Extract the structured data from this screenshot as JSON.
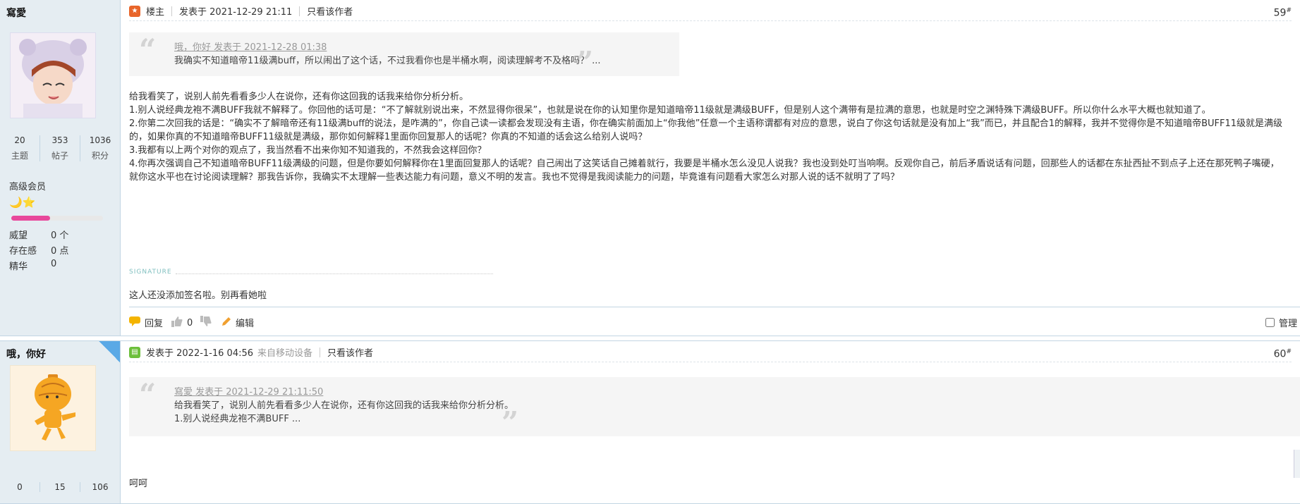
{
  "post1": {
    "user": {
      "name": "寫愛",
      "stats": [
        {
          "num": "20",
          "label": "主题"
        },
        {
          "num": "353",
          "label": "帖子"
        },
        {
          "num": "1036",
          "label": "积分"
        }
      ],
      "rank": "高级会员",
      "level_icons": "🌙⭐",
      "progress_fraction": 0.42,
      "attrs": [
        {
          "label": "威望",
          "value": "0 个"
        },
        {
          "label": "存在感",
          "value": "0 点"
        },
        {
          "label": "精华",
          "value": "0"
        }
      ]
    },
    "header": {
      "role": "楼主",
      "posted": "发表于 2021-12-29 21:11",
      "only_author": "只看该作者"
    },
    "floor": "59",
    "floor_sup": "#",
    "quote": {
      "meta": "哦，你好 发表于 2021-12-28 01:38",
      "text": "我确实不知道暗帝11级满buff，所以闹出了这个话，不过我看你也是半桶水啊，阅读理解考不及格吗？ ..."
    },
    "body": [
      "给我看笑了，说别人前先看看多少人在说你，还有你这回我的话我来给你分析分析。",
      "1.别人说经典龙袍不满BUFF我就不解释了。你回他的话可是：“不了解就别说出来，不然显得你很呆”，也就是说在你的认知里你是知道暗帝11级就是满级BUFF，但是别人这个满带有是拉满的意思，也就是时空之渊特殊下满级BUFF。所以你什么水平大概也就知道了。",
      "2.你第二次回我的话是：“确实不了解暗帝还有11级满buff的说法，是咋满的”，你自己读一读都会发现没有主语，你在确实前面加上“你我他”任意一个主语称谓都有对应的意思，说白了你这句话就是没有加上“我”而已，并且配合1的解释，我并不觉得你是不知道暗帝BUFF11级就是满级的，如果你真的不知道暗帝BUFF11级就是满级，那你如何解释1里面你回复那人的话呢？你真的不知道的话会这么给别人说吗？",
      "3.我都有以上两个对你的观点了，我当然看不出来你知不知道我的，不然我会这样回你？",
      "4.你再次强调自己不知道暗帝BUFF11级满级的问题，但是你要如何解释你在1里面回复那人的话呢？自己闹出了这笑话自己摊着就行，我要是半桶水怎么没见人说我？我也没到处叮当响啊。反观你自己，前后矛盾说话有问题，回那些人的话都在东扯西扯不到点子上还在那死鸭子嘴硬，就你这水平也在讨论阅读理解？那我告诉你，我确实不太理解一些表达能力有问题，意义不明的发言。我也不觉得是我阅读能力的问题，毕竟谁有问题看大家怎么对那人说的话不就明了了吗？"
    ],
    "signature_label": "SIGNATURE",
    "signature": "这人还没添加签名啦。别再看她啦",
    "actions": {
      "reply": "回复",
      "like_count": "0",
      "edit": "编辑",
      "manage": "管理"
    }
  },
  "post2": {
    "user": {
      "name": "哦，你好",
      "stats": [
        {
          "num": "0"
        },
        {
          "num": "15"
        },
        {
          "num": "106"
        }
      ]
    },
    "header": {
      "posted": "发表于 2022-1-16 04:56",
      "device": "来自移动设备",
      "only_author": "只看该作者"
    },
    "floor": "60",
    "floor_sup": "#",
    "quote": {
      "meta": "寫愛 发表于 2021-12-29 21:11:50",
      "line1": "给我看笑了，说别人前先看看多少人在说你，还有你这回我的话我来给你分析分析。",
      "line2": "1.别人说经典龙袍不满BUFF ..."
    },
    "body": "呵呵"
  },
  "colors": {
    "sidebar_bg": "#e5edf2",
    "border": "#c2d5e3",
    "progress": "#e8489b",
    "quote_bg": "#f5f5f5"
  }
}
